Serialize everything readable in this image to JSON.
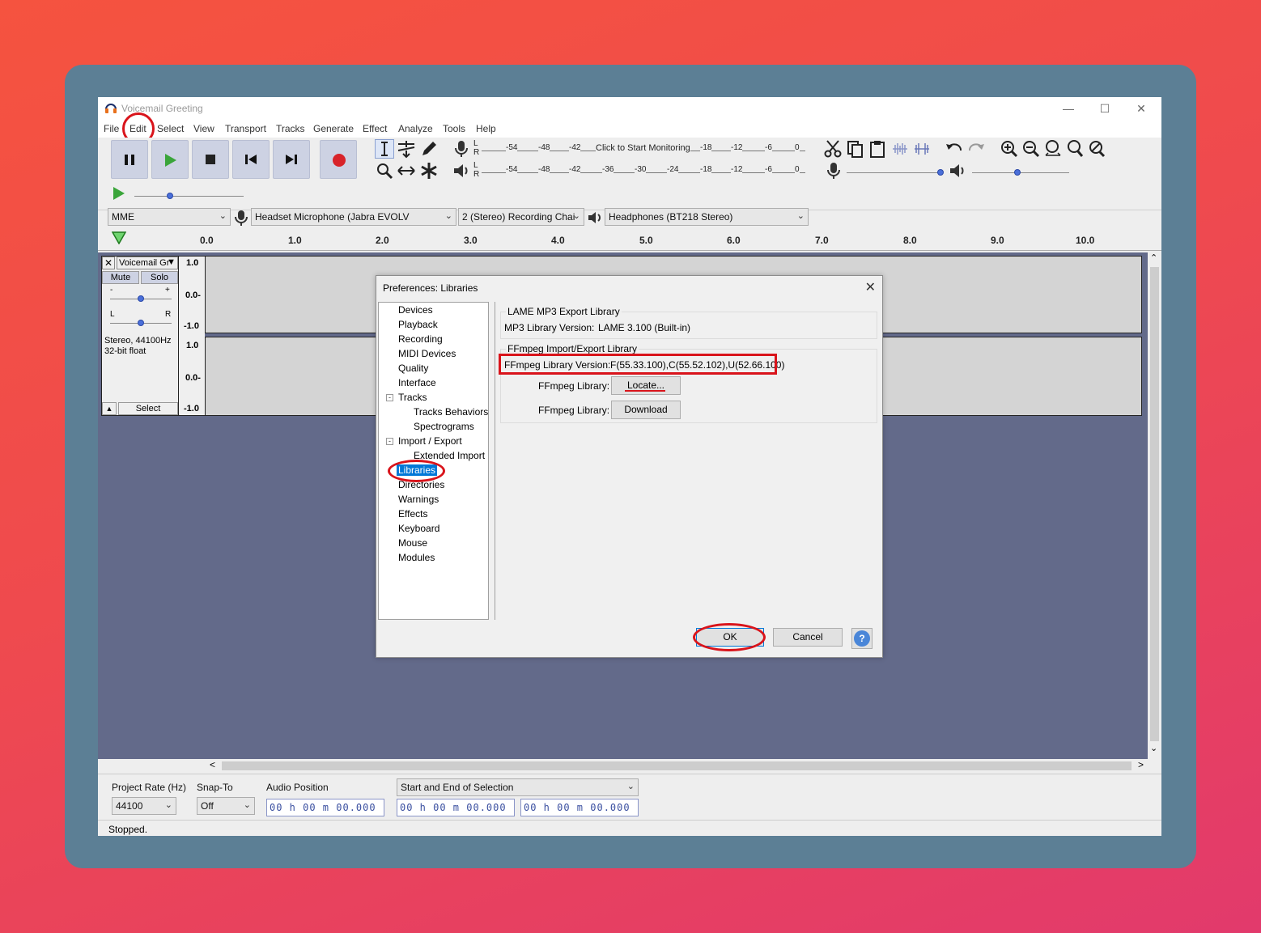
{
  "window": {
    "title": "Voicemail Greeting"
  },
  "menu": [
    "File",
    "Edit",
    "Select",
    "View",
    "Transport",
    "Tracks",
    "Generate",
    "Effect",
    "Analyze",
    "Tools",
    "Help"
  ],
  "meters": {
    "record_ticks": [
      "-54",
      "-48",
      "-42",
      "-18",
      "-12",
      "-6",
      "0"
    ],
    "record_prompt": "Click to Start Monitoring",
    "play_ticks": [
      "-54",
      "-48",
      "-42",
      "-36",
      "-30",
      "-24",
      "-18",
      "-12",
      "-6",
      "0"
    ],
    "channel_l": "L",
    "channel_r": "R"
  },
  "devices": {
    "host": "MME",
    "recording_device": "Headset Microphone (Jabra EVOLV",
    "channels": "2 (Stereo) Recording Chai",
    "playback_device": "Headphones (BT218 Stereo)"
  },
  "timeline": {
    "ticks": [
      "0.0",
      "1.0",
      "2.0",
      "3.0",
      "4.0",
      "5.0",
      "6.0",
      "7.0",
      "8.0",
      "9.0",
      "10.0"
    ]
  },
  "track": {
    "name": "Voicemail Gr",
    "mute": "Mute",
    "solo": "Solo",
    "gain_minus": "-",
    "gain_plus": "+",
    "pan_l": "L",
    "pan_r": "R",
    "info_line1": "Stereo, 44100Hz",
    "info_line2": "32-bit float",
    "select": "Select",
    "scale": [
      "1.0",
      "0.0-",
      "-1.0",
      "1.0",
      "0.0-",
      "-1.0"
    ]
  },
  "selection_bar": {
    "project_rate_label": "Project Rate (Hz)",
    "project_rate": "44100",
    "snap_label": "Snap-To",
    "snap_value": "Off",
    "audio_position_label": "Audio Position",
    "audio_position": "00 h 00 m 00.000 s",
    "selection_mode": "Start and End of Selection",
    "sel_start": "00 h 00 m 00.000 s",
    "sel_end": "00 h 00 m 00.000 s"
  },
  "status": "Stopped.",
  "dialog": {
    "title": "Preferences: Libraries",
    "tree": [
      {
        "label": "Devices",
        "level": 1
      },
      {
        "label": "Playback",
        "level": 1
      },
      {
        "label": "Recording",
        "level": 1
      },
      {
        "label": "MIDI Devices",
        "level": 1
      },
      {
        "label": "Quality",
        "level": 1
      },
      {
        "label": "Interface",
        "level": 1
      },
      {
        "label": "Tracks",
        "level": 1,
        "expander": "-"
      },
      {
        "label": "Tracks Behaviors",
        "level": 2
      },
      {
        "label": "Spectrograms",
        "level": 2
      },
      {
        "label": "Import / Export",
        "level": 1,
        "expander": "-"
      },
      {
        "label": "Extended Import",
        "level": 2
      },
      {
        "label": "Libraries",
        "level": 1,
        "selected": true
      },
      {
        "label": "Directories",
        "level": 1
      },
      {
        "label": "Warnings",
        "level": 1
      },
      {
        "label": "Effects",
        "level": 1
      },
      {
        "label": "Keyboard",
        "level": 1
      },
      {
        "label": "Mouse",
        "level": 1
      },
      {
        "label": "Modules",
        "level": 1
      }
    ],
    "lame_group": "LAME MP3 Export Library",
    "mp3_version_label": "MP3 Library Version:",
    "mp3_version": "LAME 3.100 (Built-in)",
    "ffmpeg_group": "FFmpeg Import/Export Library",
    "ffmpeg_version_label": "FFmpeg Library Version:",
    "ffmpeg_version": "F(55.33.100),C(55.52.102),U(52.66.100)",
    "ffmpeg_locate_label": "FFmpeg Library:",
    "locate_button": "Locate...",
    "ffmpeg_download_label": "FFmpeg Library:",
    "download_button": "Download",
    "ok_button": "OK",
    "cancel_button": "Cancel",
    "help_button": "?"
  },
  "colors": {
    "annotation": "#d9141b",
    "selected_item": "#0078d7",
    "track_background": "#636a8a",
    "transport_button": "#cdd2e3",
    "play_green": "#3aa53a",
    "record_red": "#d8232a"
  }
}
